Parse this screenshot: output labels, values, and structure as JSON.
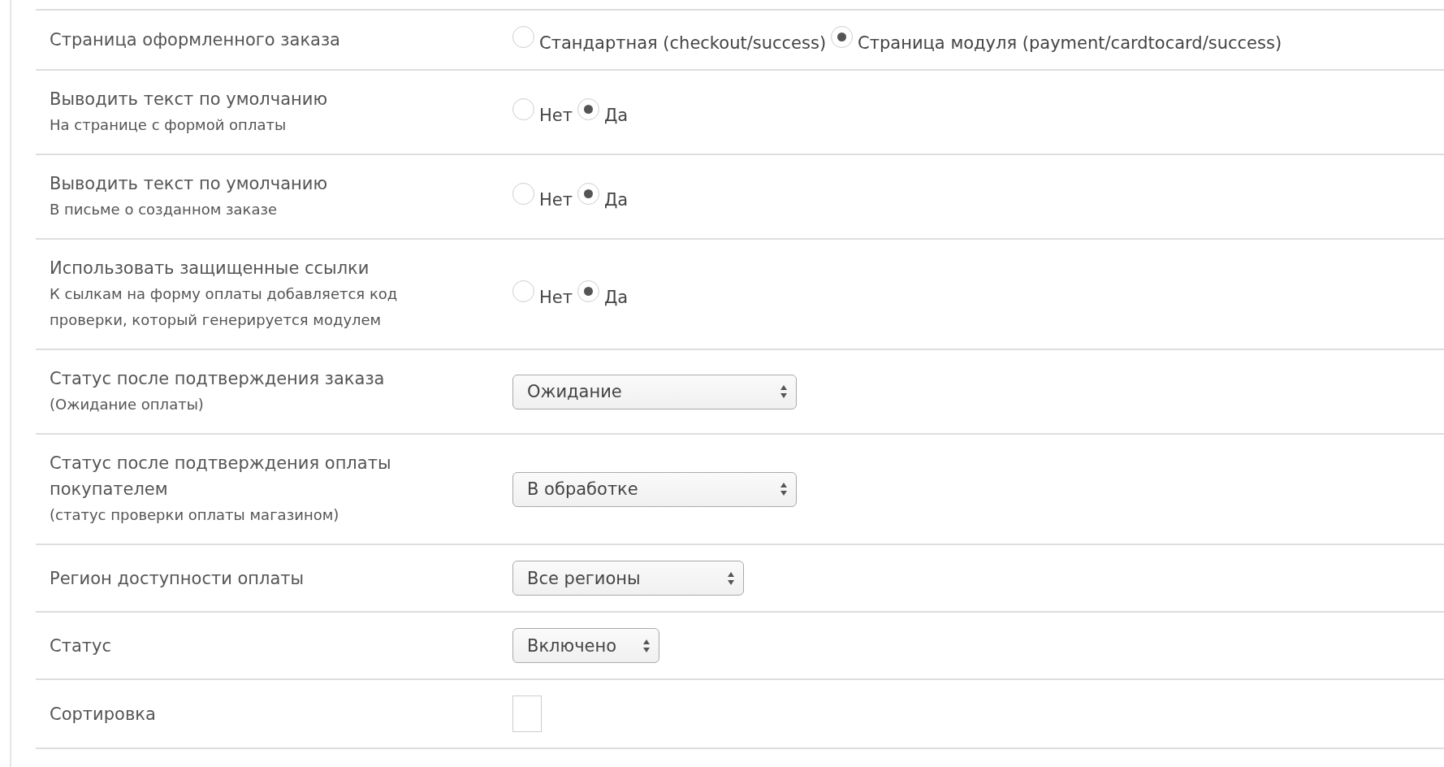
{
  "rows": [
    {
      "label": "Страница оформленного заказа",
      "notes": [],
      "kind": "radio",
      "options": [
        {
          "label": "Стандартная (checkout/success)",
          "selected": false
        },
        {
          "label": "Страница модуля (payment/cardtocard/success)",
          "selected": true
        }
      ]
    },
    {
      "label": "Выводить текст по умолчанию",
      "notes": [
        "На странице с формой оплаты"
      ],
      "kind": "radio",
      "options": [
        {
          "label": "Нет",
          "selected": false
        },
        {
          "label": "Да",
          "selected": true
        }
      ]
    },
    {
      "label": "Выводить текст по умолчанию",
      "notes": [
        "В письме о созданном заказе"
      ],
      "kind": "radio",
      "options": [
        {
          "label": "Нет",
          "selected": false
        },
        {
          "label": "Да",
          "selected": true
        }
      ]
    },
    {
      "label": "Использовать защищенные ссылки",
      "notes": [
        "К сылкам на форму оплаты добавляется код проверки, который генерируется модулем"
      ],
      "kind": "radio",
      "options": [
        {
          "label": "Нет",
          "selected": false
        },
        {
          "label": "Да",
          "selected": true
        }
      ]
    },
    {
      "label": "Статус после подтверждения заказа",
      "notes": [
        "(Ожидание оплаты)"
      ],
      "kind": "select",
      "value": "Ожидание"
    },
    {
      "label": "Статус после подтверждения оплаты покупателем",
      "notes": [
        "(статус проверки оплаты магазином)"
      ],
      "kind": "select",
      "value": "В обработке"
    },
    {
      "label": "Регион доступности оплаты",
      "notes": [],
      "kind": "select",
      "value": "Все регионы"
    },
    {
      "label": "Статус",
      "notes": [],
      "kind": "select",
      "value": "Включено"
    },
    {
      "label": "Сортировка",
      "notes": [],
      "kind": "input"
    }
  ]
}
